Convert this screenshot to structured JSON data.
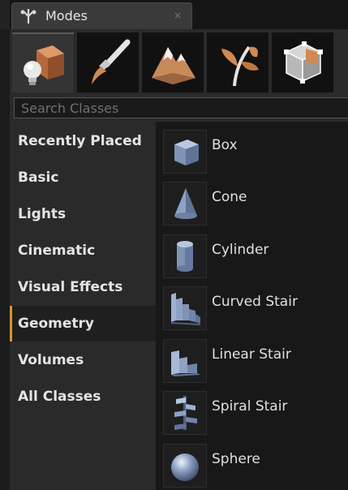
{
  "window": {
    "title": "Modes",
    "close_glyph": "×"
  },
  "toolbar": {
    "buttons": [
      {
        "name": "place-mode",
        "icon": "cube-lightbulb-icon",
        "active": true
      },
      {
        "name": "paint-mode",
        "icon": "paintbrush-icon",
        "active": false
      },
      {
        "name": "landscape-mode",
        "icon": "mountain-icon",
        "active": false
      },
      {
        "name": "foliage-mode",
        "icon": "leaf-icon",
        "active": false
      },
      {
        "name": "geometry-edit-mode",
        "icon": "geometry-cube-icon",
        "active": false
      }
    ]
  },
  "search": {
    "placeholder": "Search Classes",
    "value": ""
  },
  "categories": [
    {
      "label": "Recently Placed",
      "selected": false
    },
    {
      "label": "Basic",
      "selected": false
    },
    {
      "label": "Lights",
      "selected": false
    },
    {
      "label": "Cinematic",
      "selected": false
    },
    {
      "label": "Visual Effects",
      "selected": false
    },
    {
      "label": "Geometry",
      "selected": true
    },
    {
      "label": "Volumes",
      "selected": false
    },
    {
      "label": "All Classes",
      "selected": false
    }
  ],
  "items": [
    {
      "label": "Box",
      "icon": "box-icon"
    },
    {
      "label": "Cone",
      "icon": "cone-icon"
    },
    {
      "label": "Cylinder",
      "icon": "cylinder-icon"
    },
    {
      "label": "Curved Stair",
      "icon": "curved-stair-icon"
    },
    {
      "label": "Linear Stair",
      "icon": "linear-stair-icon"
    },
    {
      "label": "Spiral Stair",
      "icon": "spiral-stair-icon"
    },
    {
      "label": "Sphere",
      "icon": "sphere-icon"
    }
  ],
  "colors": {
    "accent": "#d9962a",
    "shape": "#8fa3c2",
    "orange": "#c9824e"
  }
}
